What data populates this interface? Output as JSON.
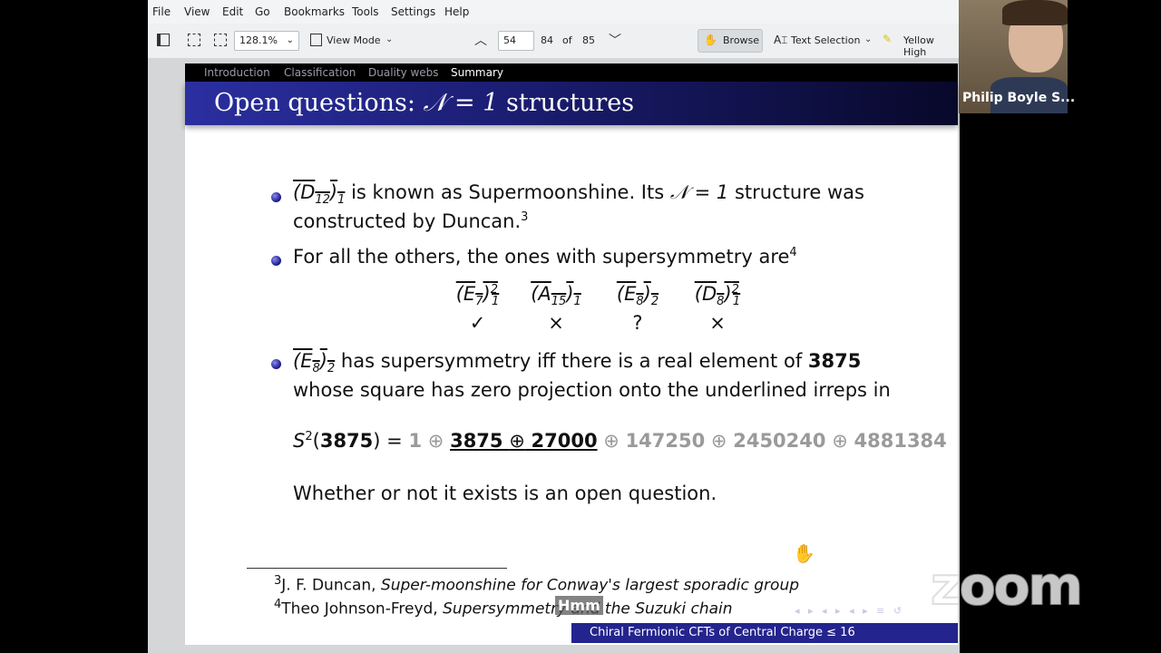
{
  "menu": [
    "File",
    "View",
    "Edit",
    "Go",
    "Bookmarks",
    "Tools",
    "Settings",
    "Help"
  ],
  "toolbar": {
    "zoom_value": "128.1%",
    "view_mode": "View Mode",
    "page_current": "54",
    "page_label": "84",
    "page_of": "of",
    "page_total": "85",
    "browse": "Browse",
    "text_selection": "Text Selection",
    "highlighter": "Yellow High"
  },
  "slide": {
    "nav": [
      "Introduction",
      "Classification",
      "Duality webs",
      "Summary"
    ],
    "title_prefix": "Open questions:",
    "title_math": "𝒩 = 1",
    "title_suffix": "structures",
    "b1_math": "(D",
    "b1_sub": "12",
    "b1_close": ")",
    "b1_sub2": "1",
    "b1_text1": "is known as Supermoonshine. Its",
    "b1_n": "𝒩 = 1",
    "b1_text2": "structure was",
    "b1_line2": "constructed by Duncan.",
    "b1_ref": "3",
    "b2_text": "For all the others, the ones with supersymmetry are",
    "b2_ref": "4",
    "table": [
      {
        "base": "(E",
        "sub": "7",
        "sup": "2",
        "close": ")",
        "sub2": "1",
        "mark": "✓"
      },
      {
        "base": "(A",
        "sub": "15",
        "sup": "",
        "close": ")",
        "sub2": "1",
        "mark": "×"
      },
      {
        "base": "(E",
        "sub": "8",
        "sup": "",
        "close": ")",
        "sub2": "2",
        "mark": "?"
      },
      {
        "base": "(D",
        "sub": "8",
        "sup": "2",
        "close": ")",
        "sub2": "1",
        "mark": "×"
      }
    ],
    "b3_math": "(E",
    "b3_sub": "8",
    "b3_close": ")",
    "b3_sub2": "2",
    "b3_text1": "has supersymmetry iff there is a real element of",
    "b3_bold": "3875",
    "b3_line2": "whose square has zero projection onto the underlined irreps in",
    "eq_lhs_s": "S",
    "eq_lhs_sup": "2",
    "eq_lhs_open": "(",
    "eq_lhs_num": "3875",
    "eq_lhs_close": ")",
    "eq_equals": "=",
    "eq_terms": [
      "1",
      "3875",
      "27000",
      "147250",
      "2450240",
      "4881384"
    ],
    "eq_oplus": "⊕",
    "closing": "Whether or not it exists is an open question.",
    "foot3_num": "3",
    "foot3_author": "J. F. Duncan,",
    "foot3_title": "Super-moonshine for Conway's largest sporadic group",
    "foot4_num": "4",
    "foot4_author": "Theo Johnson-Freyd,",
    "foot4_title": "Supersymmetry and the Suzuki chain",
    "footline": "Chiral Fermionic CFTs of Central Charge ≤ 16"
  },
  "video": {
    "participant": "Philip Boyle S..."
  },
  "overlay": {
    "reaction": "Hmm",
    "logo": "zoom"
  },
  "colors": {
    "title_bar": "#24248e",
    "footline": "#24248e",
    "bullet": "#22229a"
  }
}
